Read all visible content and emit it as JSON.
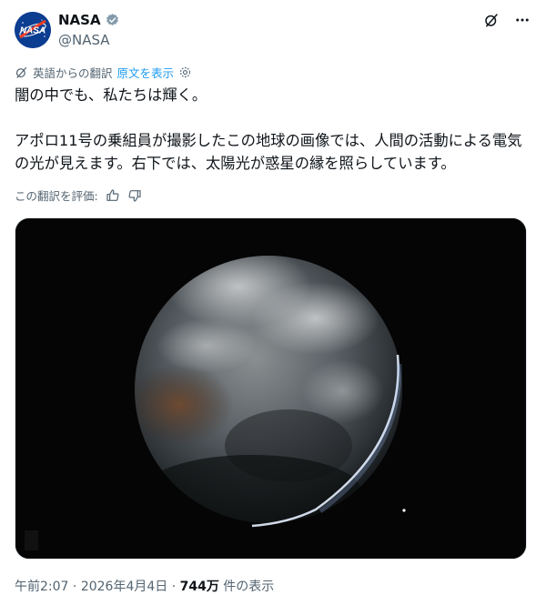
{
  "author": {
    "display_name": "NASA",
    "handle": "@NASA",
    "verified": true,
    "avatar_text": "NASA"
  },
  "icons": {
    "grok": "grok-icon",
    "more": "more-icon",
    "translate": "translate-icon",
    "settings": "gear-icon",
    "like": "thumbs-up-icon",
    "dislike": "thumbs-down-icon"
  },
  "translation": {
    "label": "英語からの翻訳",
    "show_original": "原文を表示",
    "rate_label": "この翻訳を評価:"
  },
  "tweet": {
    "line1": "闇の中でも、私たちは輝く。",
    "line2": "アポロ11号の乗組員が撮影したこの地球の画像では、人間の活動による電気の光が見えます。右下では、太陽光が惑星の縁を照らしています。"
  },
  "footer": {
    "time": "午前2:07",
    "sep": " · ",
    "date": "2026年4月4日",
    "views_count": "744万",
    "views_label": " 件の表示"
  },
  "colors": {
    "link": "#1d9bf0",
    "verified": "#829aab",
    "muted": "#536471"
  }
}
